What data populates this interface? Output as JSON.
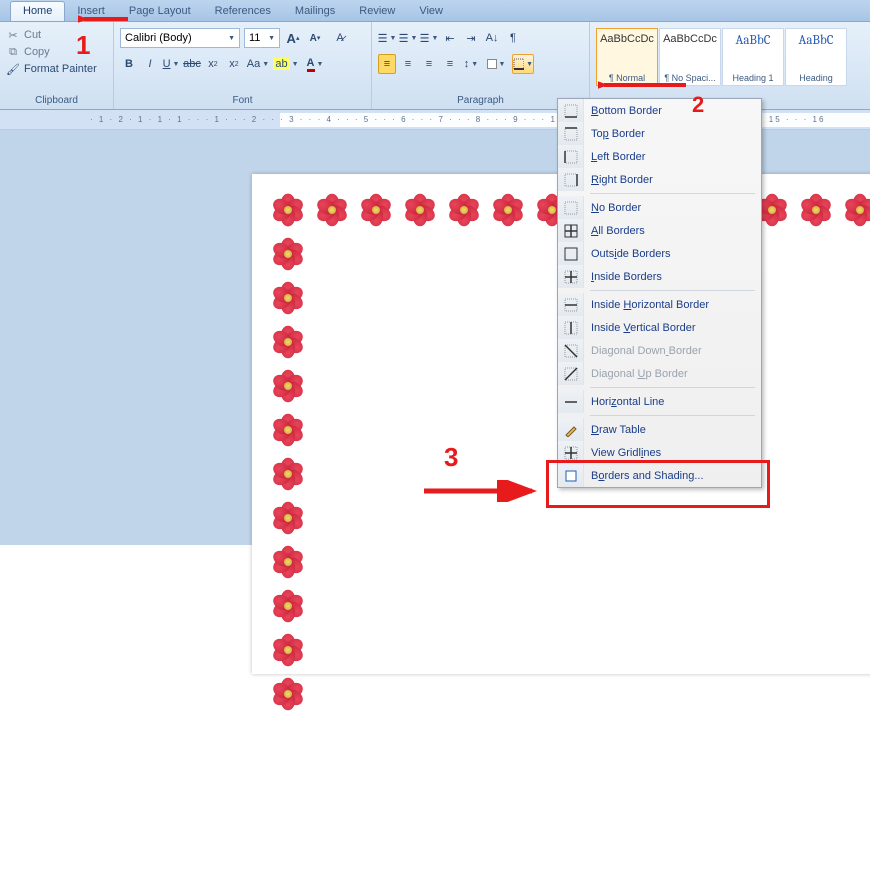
{
  "tabs": [
    "Home",
    "Insert",
    "Page Layout",
    "References",
    "Mailings",
    "Review",
    "View"
  ],
  "active_tab": 0,
  "clipboard": {
    "cut": "Cut",
    "copy": "Copy",
    "format_painter": "Format Painter",
    "label": "Clipboard"
  },
  "font": {
    "name": "Calibri (Body)",
    "size": "11",
    "label": "Font",
    "buttons": {
      "grow": "A",
      "shrink": "A",
      "clear": "Aa",
      "bold": "B",
      "italic": "I",
      "underline": "U",
      "strike": "abc",
      "sub": "x₂",
      "sup": "x²",
      "case": "Aa",
      "highlight": "ab",
      "color": "A"
    }
  },
  "paragraph": {
    "label": "Paragraph"
  },
  "styles": [
    {
      "preview": "AaBbCcDc",
      "name": "¶ Normal",
      "cls": ""
    },
    {
      "preview": "AaBbCcDc",
      "name": "¶ No Spaci...",
      "cls": ""
    },
    {
      "preview": "AaBbC",
      "name": "Heading 1",
      "cls": "blue"
    },
    {
      "preview": "AaBbC",
      "name": "Heading",
      "cls": "blue"
    }
  ],
  "ruler_text": "· 1 · 2 · 1 · 1 · 1 · · · 1 · · · 2 · · · 3 · · · 4 · · · 5 · · · 6 · · · 7 · · · 8 · · · 9 · · · 10 · · · 11 · · · 12 · · · 13 · · · 14 · · · 15 · · · 16",
  "dropdown": [
    {
      "label": "Bottom Border",
      "u": 0,
      "icon": "bb",
      "en": true
    },
    {
      "label": "Top Border",
      "u": 2,
      "icon": "tb",
      "en": true
    },
    {
      "label": "Left Border",
      "u": 0,
      "icon": "lb",
      "en": true
    },
    {
      "label": "Right Border",
      "u": 0,
      "icon": "rb",
      "en": true
    },
    {
      "sep": true
    },
    {
      "label": "No Border",
      "u": 0,
      "icon": "nb",
      "en": true
    },
    {
      "label": "All Borders",
      "u": 0,
      "icon": "ab",
      "en": true
    },
    {
      "label": "Outside Borders",
      "u": 4,
      "icon": "ob",
      "en": true
    },
    {
      "label": "Inside Borders",
      "u": 0,
      "icon": "ib",
      "en": true
    },
    {
      "sep": true
    },
    {
      "label": "Inside Horizontal Border",
      "u": 7,
      "icon": "ihb",
      "en": true
    },
    {
      "label": "Inside Vertical Border",
      "u": 7,
      "icon": "ivb",
      "en": true
    },
    {
      "label": "Diagonal Down Border",
      "u": 13,
      "icon": "ddb",
      "en": false
    },
    {
      "label": "Diagonal Up Border",
      "u": 9,
      "icon": "dub",
      "en": false
    },
    {
      "sep": true
    },
    {
      "label": "Horizontal Line",
      "u": 4,
      "icon": "hl",
      "en": true
    },
    {
      "sep": true
    },
    {
      "label": "Draw Table",
      "u": 0,
      "icon": "dt",
      "en": true
    },
    {
      "label": "View Gridlines",
      "u": 10,
      "icon": "vg",
      "en": true
    },
    {
      "label": "Borders and Shading...",
      "u": 1,
      "icon": "bs",
      "en": true
    }
  ],
  "annotations": {
    "n1": "1",
    "n2": "2",
    "n3": "3"
  }
}
